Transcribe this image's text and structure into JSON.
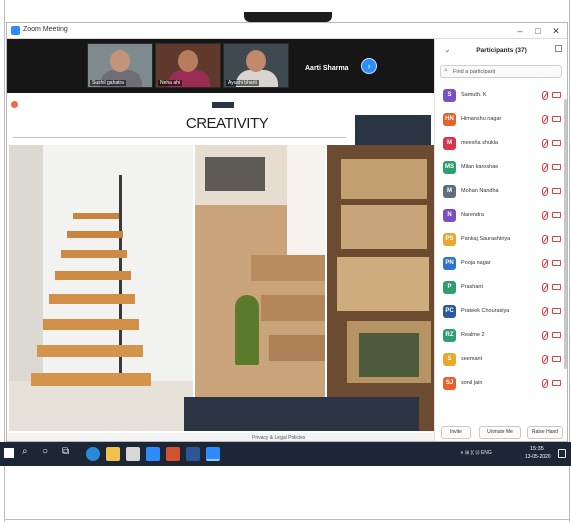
{
  "window": {
    "title": "Zoom Meeting",
    "minimize": "–",
    "maximize": "□",
    "close": "✕"
  },
  "strip": {
    "thumbnails": [
      {
        "name": "Sushil gahatra",
        "skin": "#c49478",
        "shirt": "#6d6d75",
        "bg": "#7f8a8e"
      },
      {
        "name": "Neha ahi",
        "skin": "#b77c5e",
        "shirt": "#9b2d55",
        "bg": "#5f3a2c"
      },
      {
        "name": "Ayushi bharti",
        "skin": "#c3896b",
        "shirt": "#d8d5cf",
        "bg": "#3f4a50"
      }
    ],
    "active_speaker": "Aarti Sharma",
    "next_arrow": "›"
  },
  "slide": {
    "title": "CREATIVITY",
    "footer_link": "Privacy & Legal Policies"
  },
  "participants": {
    "title": "Participants (37)",
    "collapse_arrow": "⌄",
    "search_placeholder": "Find a participant",
    "search_icon": "search-icon",
    "list": [
      {
        "initial": "S",
        "color": "#7b4fc4",
        "name": "Samuth. K"
      },
      {
        "initial": "HN",
        "color": "#e8612c",
        "name": "Himanshu nagar"
      },
      {
        "initial": "M",
        "color": "#d8364a",
        "name": "meesha shukla"
      },
      {
        "initial": "MS",
        "color": "#2f9e6e",
        "name": "Milan karoshae"
      },
      {
        "initial": "M",
        "color": "#5c6e80",
        "name": "Mohan Nandha"
      },
      {
        "initial": "N",
        "color": "#7b4fc4",
        "name": "Narendra"
      },
      {
        "initial": "PS",
        "color": "#e8a82c",
        "name": "Pankaj Saurashtriya"
      },
      {
        "initial": "PN",
        "color": "#2b74d0",
        "name": "Pooja nagar"
      },
      {
        "initial": "P",
        "color": "#2f9e6e",
        "name": "Prashant"
      },
      {
        "initial": "PC",
        "color": "#2b5b9e",
        "name": "Prateek Chourasiya"
      },
      {
        "initial": "RZ",
        "color": "#2f9e6e",
        "name": "Realme 2"
      },
      {
        "initial": "S",
        "color": "#e8a82c",
        "name": "seemant"
      },
      {
        "initial": "SJ",
        "color": "#e8612c",
        "name": "sonil jain"
      }
    ],
    "footer": {
      "invite": "Invite",
      "unmute": "Unmute Me",
      "raise": "Raise Hand"
    }
  },
  "taskbar": {
    "search_glyph": "⌕",
    "cortana_glyph": "○",
    "taskview_glyph": "⧉",
    "tray": "∧  ⊞  ((  ⊡  ENG",
    "time": "15:35",
    "date": "13-05-2020"
  },
  "colors": {
    "zoom_blue": "#2d8cff",
    "slide_dark": "#2a3442",
    "muted_red": "#d84444",
    "taskbar": "#1d2634"
  }
}
